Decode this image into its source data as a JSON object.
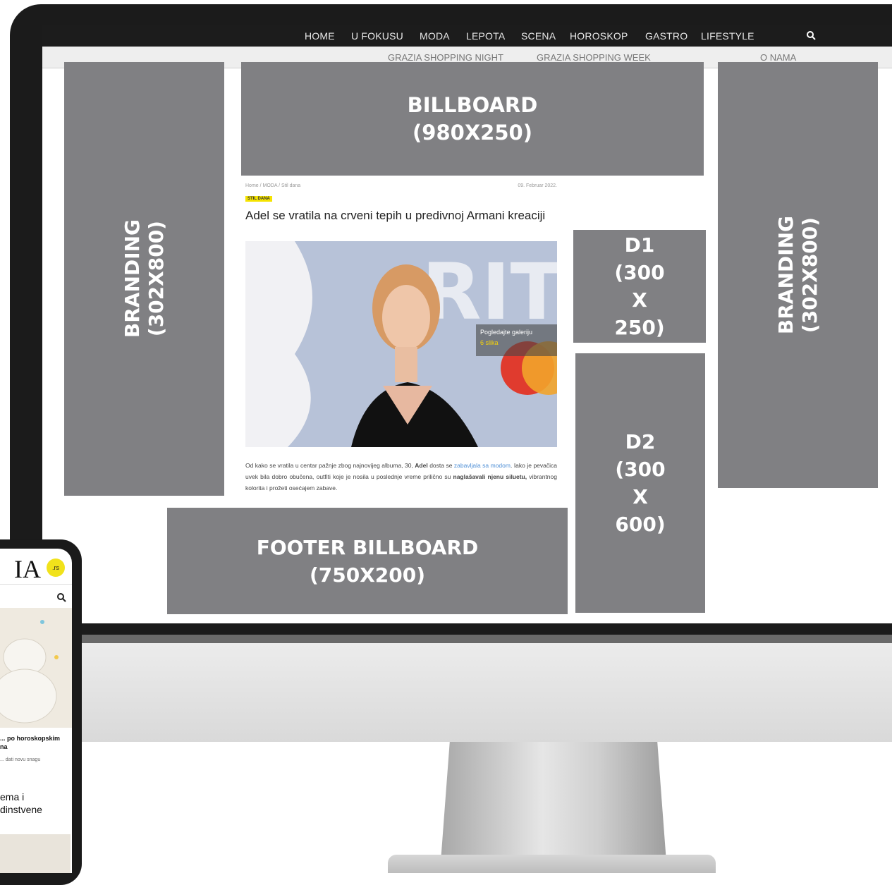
{
  "nav": {
    "primary": [
      "HOME",
      "U FOKUSU",
      "MODA",
      "LEPOTA",
      "SCENA",
      "HOROSKOP",
      "GASTRO",
      "LIFESTYLE"
    ],
    "secondary": [
      "GRAZIA SHOPPING NIGHT",
      "GRAZIA SHOPPING WEEK"
    ],
    "about": "O NAMA",
    "search_icon": "search-icon"
  },
  "ads": {
    "billboard": [
      "BILLBOARD",
      "(980X250)"
    ],
    "branding_left": [
      "BRANDING",
      "(302X800)"
    ],
    "branding_right": [
      "BRANDING",
      "(302X800)"
    ],
    "d1": [
      "D1",
      "(300",
      "X",
      "250)"
    ],
    "d2": [
      "D2",
      "(300",
      "X",
      "600)"
    ],
    "footer_billboard": [
      "FOOTER BILLBOARD",
      "(750X200)"
    ]
  },
  "article": {
    "breadcrumb": "Home / MODA / Stil dana",
    "date": "09. Februar 2022.",
    "tag": "STIL DANA",
    "title": "Adel se vratila na crveni tepih u predivnoj Armani kreaciji",
    "gallery_label": "Pogledajte galeriju",
    "gallery_count": "6 slika",
    "body": {
      "p1": "Od kako se vratila u centar pažnje zbog najnovijeg albuma, 30, ",
      "b1": "Adel",
      "p2": " dosta se ",
      "link": "zabavljala sa modom",
      "p3": ". Iako je pevačica uvek bila dobro obučena, outfiti koje je nosila u poslednje vreme prilično su ",
      "b2": "naglašavali njenu siluetu,",
      "p4": " vibrantnog kolorita i prožeti osećajem zabave."
    }
  },
  "phone": {
    "logo_fragment": "IA",
    "logo_badge": ".rs",
    "headline1": "... po horoskopskim",
    "headline1_b": "na",
    "sub1": "... dati novu snagu",
    "headline2": "ema i",
    "headline2_b": "dinstvene"
  }
}
